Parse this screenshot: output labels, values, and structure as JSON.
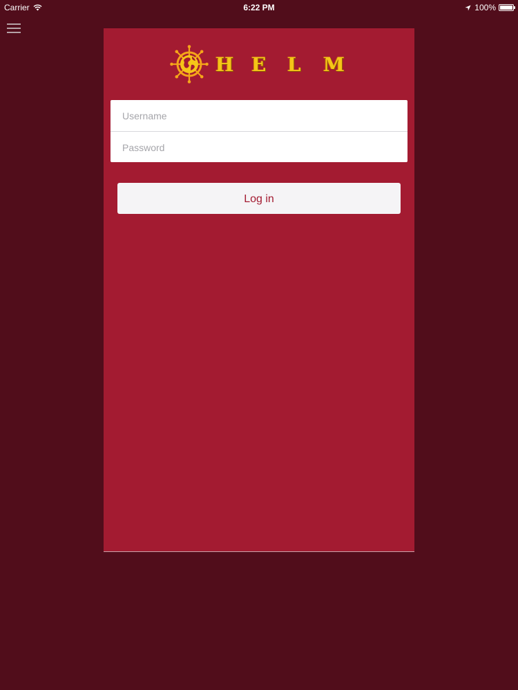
{
  "status_bar": {
    "carrier": "Carrier",
    "time": "6:22 PM",
    "battery_percent": "100%",
    "battery_level": 1.0,
    "icons": [
      "wifi-icon",
      "location-arrow-icon",
      "battery-icon"
    ]
  },
  "nav": {
    "menu_icon": "hamburger-menu-icon"
  },
  "logo": {
    "icon": "ship-wheel-globe-icon",
    "letters": [
      "H",
      "E",
      "L",
      "M"
    ]
  },
  "login_form": {
    "username_placeholder": "Username",
    "username_value": "",
    "password_placeholder": "Password",
    "password_value": "",
    "login_label": "Log in"
  },
  "colors": {
    "background": "#510d1b",
    "panel": "#a31b31",
    "logo_gold": "#f5c518",
    "button_bg": "#f5f4f6",
    "button_text": "#a31b31"
  }
}
